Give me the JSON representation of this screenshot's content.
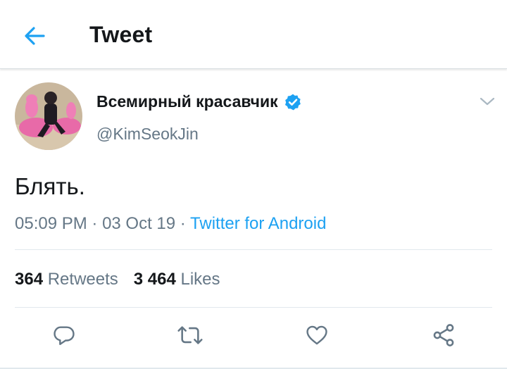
{
  "header": {
    "title": "Tweet",
    "back_icon": "arrow-left-icon",
    "accent": "#1da1f2"
  },
  "tweet": {
    "display_name": "Всемирный красавчик",
    "verified_icon": "verified-badge-icon",
    "handle": "@KimSeokJin",
    "text": "Блять.",
    "time": "05:09 PM",
    "separator1": " · ",
    "date": "03 Oct 19",
    "separator2": " · ",
    "source": "Twitter for Android"
  },
  "stats": {
    "retweets_count": "364",
    "retweets_label": "Retweets",
    "likes_count": "3 464",
    "likes_label": "Likes"
  },
  "actions": [
    {
      "name": "reply",
      "icon": "reply-bubble-icon"
    },
    {
      "name": "retweet",
      "icon": "retweet-icon"
    },
    {
      "name": "like",
      "icon": "heart-icon"
    },
    {
      "name": "share",
      "icon": "share-icon"
    }
  ],
  "colors": {
    "text": "#14171a",
    "secondary": "#657786",
    "link": "#1da1f2",
    "divider": "#e1e8ed"
  }
}
